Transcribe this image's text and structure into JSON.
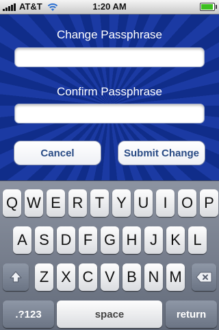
{
  "status_bar": {
    "carrier": "AT&T",
    "time": "1:20 AM"
  },
  "form": {
    "change_label": "Change Passphrase",
    "change_value": "",
    "confirm_label": "Confirm Passphrase",
    "confirm_value": "",
    "cancel_label": "Cancel",
    "submit_label": "Submit Change"
  },
  "keyboard": {
    "row1": [
      "Q",
      "W",
      "E",
      "R",
      "T",
      "Y",
      "U",
      "I",
      "O",
      "P"
    ],
    "row2": [
      "A",
      "S",
      "D",
      "F",
      "G",
      "H",
      "J",
      "K",
      "L"
    ],
    "row3": [
      "Z",
      "X",
      "C",
      "V",
      "B",
      "N",
      "M"
    ],
    "shift": "shift-icon",
    "backspace": "backspace-icon",
    "numbers_label": ".?123",
    "space_label": "space",
    "return_label": "return"
  },
  "colors": {
    "background": "#0f2a86",
    "button_text": "#284a84",
    "battery": "#3cbf1f"
  }
}
